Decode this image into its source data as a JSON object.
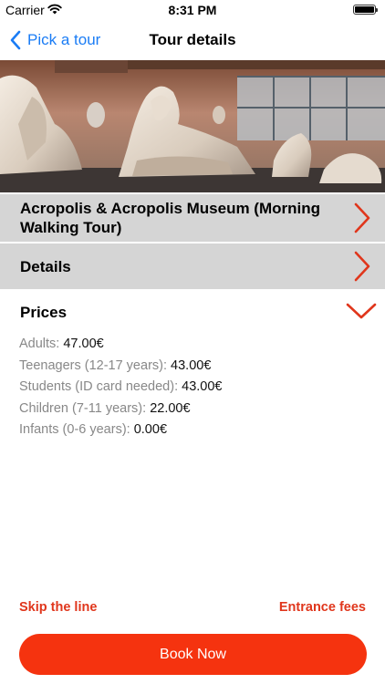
{
  "status_bar": {
    "carrier": "Carrier",
    "time": "8:31 PM",
    "icons": [
      "wifi-icon",
      "battery-icon"
    ]
  },
  "nav": {
    "back_label": "Pick a tour",
    "title": "Tour details",
    "accent_color": "#1a7cf5"
  },
  "tour": {
    "title": "Acropolis & Acropolis Museum (Morning Walking Tour)"
  },
  "details": {
    "label": "Details"
  },
  "prices": {
    "title": "Prices",
    "items": [
      {
        "label": "Adults: ",
        "value": "47.00€"
      },
      {
        "label": "Teenagers (12-17 years): ",
        "value": "43.00€"
      },
      {
        "label": "Students (ID card needed): ",
        "value": "43.00€"
      },
      {
        "label": "Children (7-11 years): ",
        "value": "22.00€"
      },
      {
        "label": "Infants (0-6 years): ",
        "value": "0.00€"
      }
    ]
  },
  "footer": {
    "skip_label": "Skip the line",
    "fees_label": "Entrance fees",
    "book_label": "Book Now",
    "brand_color": "#f5330f"
  }
}
